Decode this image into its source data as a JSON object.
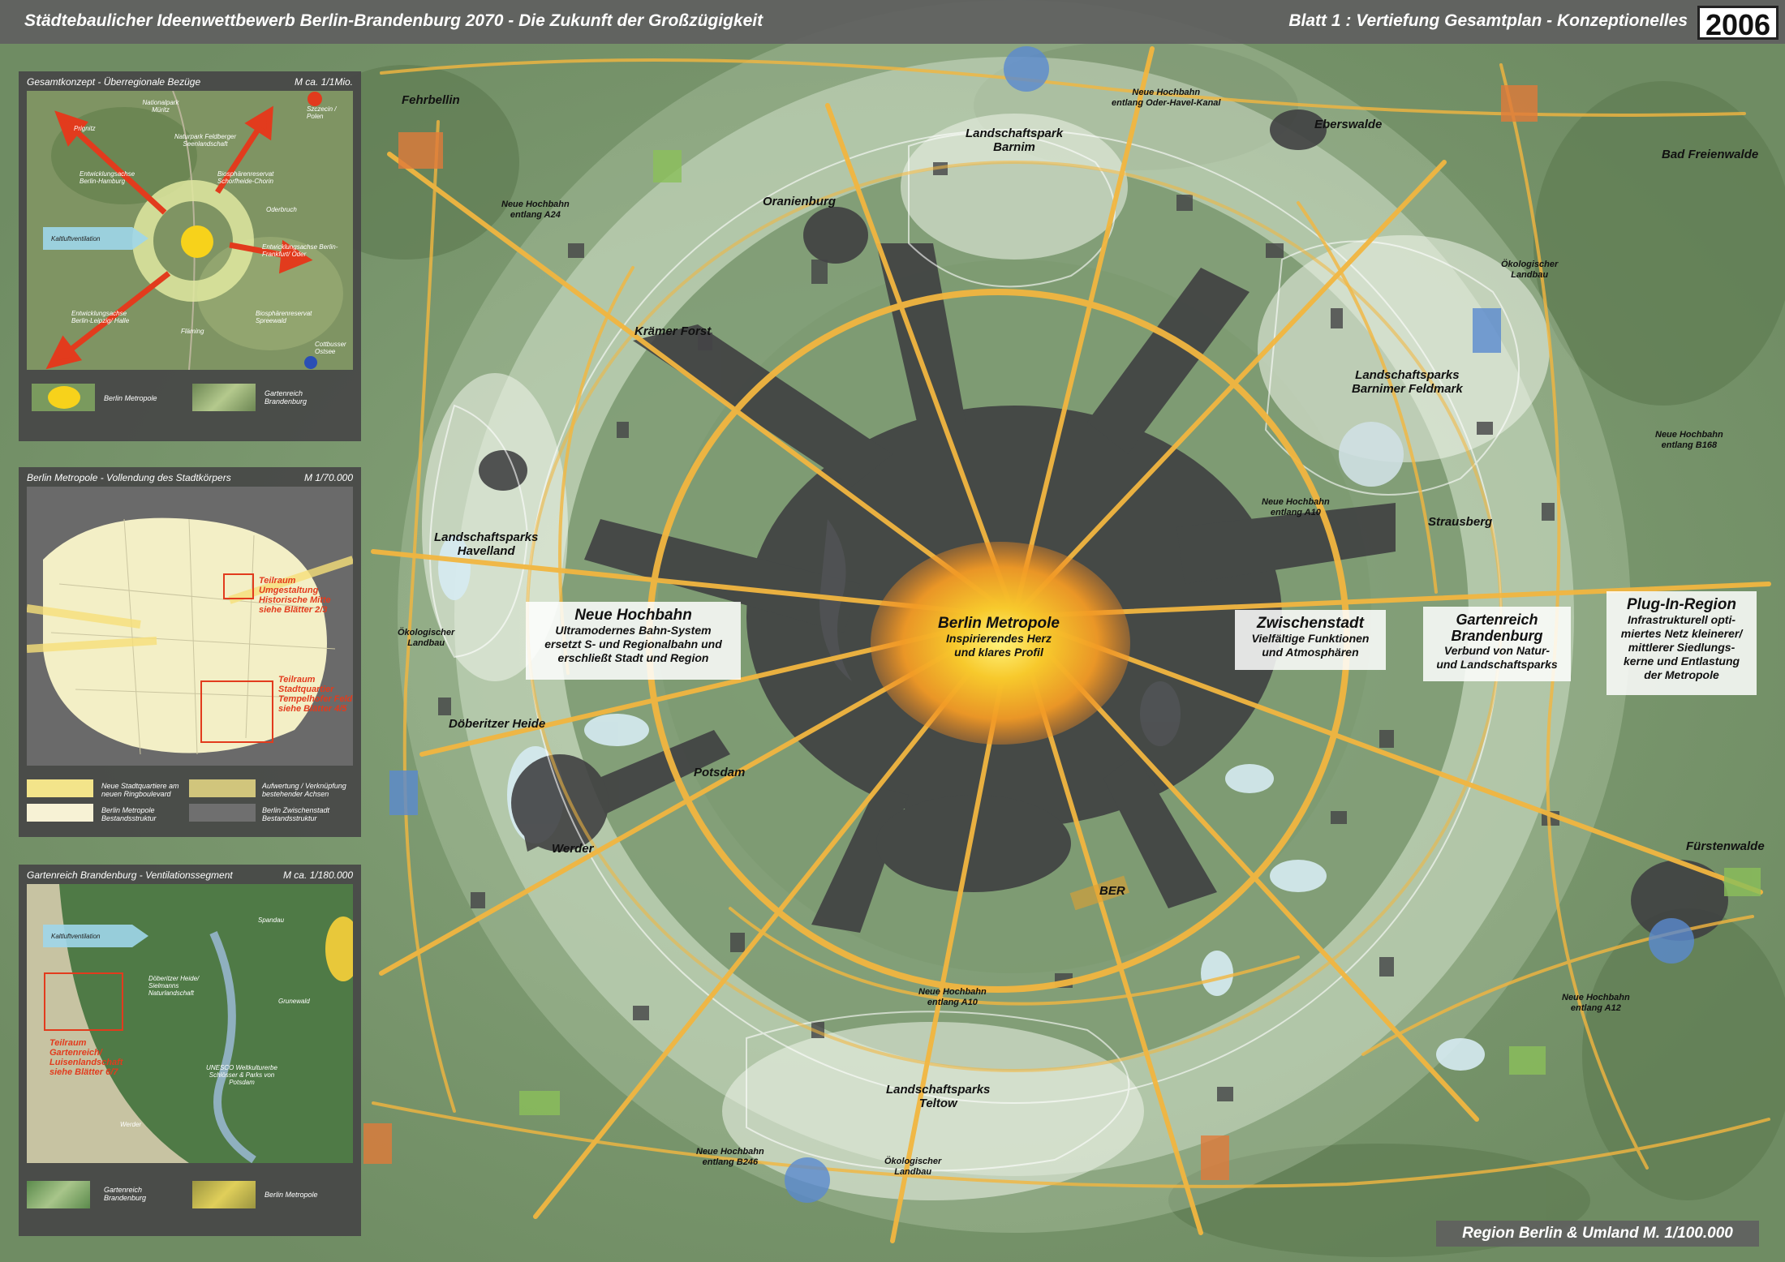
{
  "header": {
    "title_left": "Städtebaulicher Ideenwettbewerb  Berlin-Brandenburg 2070  -  Die Zukunft der Großzügigkeit",
    "title_right": "Blatt 1 :  Vertiefung Gesamtplan  -  Konzeptionelles",
    "year": "2006"
  },
  "panels": {
    "p1": {
      "title": "Gesamtkonzept  -  Überregionale Bezüge",
      "scale": "M ca. 1/1Mio.",
      "labels": {
        "prignitz": "Prignitz",
        "mueritz": "Nationalpark Müritz",
        "feldberg": "Naturpark Feldberger Seenlandschaft",
        "szczecin": "Szczecin / Polen",
        "hamburg": "Entwicklungsachse Berlin-Hamburg",
        "schorfheide": "Biosphärenreservat Schorfheide-Chorin",
        "oderbruch": "Oderbruch",
        "kaltluft": "Kaltluftventilation",
        "frankfurt": "Entwicklungsachse Berlin-Frankfurt/ Oder",
        "leipzig": "Entwicklungsachse Berlin-Leipzig/ Halle",
        "flaeming": "Fläming",
        "spreewald": "Biosphärenreservat Spreewald",
        "cottbus": "Cottbusser Ostsee"
      },
      "legend": [
        "Berlin Metropole",
        "Gartenreich Brandenburg"
      ]
    },
    "p2": {
      "title": "Berlin Metropole  -  Vollendung des Stadtkörpers",
      "scale": "M 1/70.000",
      "callout_a": [
        "Teilraum",
        "Umgestaltung",
        "Historische Mitte",
        "siehe Blätter 2/3"
      ],
      "callout_b": [
        "Teilraum",
        "Stadtquartier",
        "Tempelhofer Feld",
        "siehe Blätter 4/5"
      ],
      "legend": [
        [
          "Neue Stadtquartiere am",
          "neuen Ringboulevard"
        ],
        [
          "Aufwertung / Verknüpfung",
          "bestehender Achsen"
        ],
        [
          "Berlin Metropole",
          "Bestandsstruktur"
        ],
        [
          "Berlin Zwischenstadt",
          "Bestandsstruktur"
        ]
      ]
    },
    "p3": {
      "title": "Gartenreich Brandenburg  -  Ventilationssegment",
      "scale": "M ca. 1/180.000",
      "labels": {
        "kaltluft": "Kaltluftventilation",
        "spandau": "Spandau",
        "doeberitz": "Döberitzer Heide/ Sielmanns Naturlandschaft",
        "grunewald": "Grunewald",
        "unesco": "UNESCO Weltkulturerbe Schlösser & Parks von Potsdam",
        "werder": "Werder"
      },
      "callout": [
        "Teilraum",
        "Gartenreich/",
        "Luisenlandschaft",
        "siehe Blätter 6/7"
      ],
      "legend": [
        "Gartenreich Brandenburg",
        "Berlin Metropole"
      ]
    }
  },
  "map": {
    "places": {
      "fehrbellin": "Fehrbellin",
      "oranienburg": "Oranienburg",
      "eberswalde": "Eberswalde",
      "bad_freienwalde": "Bad Freienwalde",
      "kraemer_forst": "Krämer Forst",
      "strausberg": "Strausberg",
      "potsdam": "Potsdam",
      "werder": "Werder",
      "doeberitzer_heide": "Döberitzer Heide",
      "fuerstenwalde": "Fürstenwalde",
      "ber": "BER"
    },
    "parks": {
      "barnim": [
        "Landschaftspark",
        "Barnim"
      ],
      "barnimer_feldmark": [
        "Landschaftsparks",
        "Barnimer Feldmark"
      ],
      "havelland": [
        "Landschaftsparks",
        "Havelland"
      ],
      "teltow": [
        "Landschaftsparks",
        "Teltow"
      ]
    },
    "small_labels": {
      "hb_oder": [
        "Neue Hochbahn",
        "entlang Oder-Havel-Kanal"
      ],
      "hb_a24": [
        "Neue Hochbahn",
        "entlang A24"
      ],
      "oeko_ne": [
        "Ökologischer",
        "Landbau"
      ],
      "hb_b168": [
        "Neue Hochbahn",
        "entlang B168"
      ],
      "hb_a10_ne": [
        "Neue Hochbahn",
        "entlang A10"
      ],
      "oeko_w": [
        "Ökologischer",
        "Landbau"
      ],
      "hb_a10_s": [
        "Neue Hochbahn",
        "entlang A10"
      ],
      "hb_a12": [
        "Neue Hochbahn",
        "entlang A12"
      ],
      "hb_b246": [
        "Neue Hochbahn",
        "entlang B246"
      ],
      "oeko_s": [
        "Ökologischer",
        "Landbau"
      ]
    },
    "callouts": {
      "hochbahn": {
        "title": "Neue Hochbahn",
        "lines": [
          "Ultramodernes Bahn-System",
          "ersetzt S- und Regionalbahn und",
          "erschließt Stadt und Region"
        ]
      },
      "metropole": {
        "title": "Berlin Metropole",
        "lines": [
          "Inspirierendes Herz",
          "und klares Profil"
        ]
      },
      "zwischenstadt": {
        "title": "Zwischenstadt",
        "lines": [
          "Vielfältige Funktionen",
          "und Atmosphären"
        ]
      },
      "gartenreich": {
        "title": "Gartenreich Brandenburg",
        "lines": [
          "Verbund von Natur-",
          "und Landschaftsparks"
        ]
      },
      "plugin": {
        "title": "Plug-In-Region",
        "lines": [
          "Infrastrukturell opti-",
          "miertes Netz kleinerer/",
          "mittlerer Siedlungs-",
          "kerne und Entlastung",
          "der Metropole"
        ]
      }
    }
  },
  "footer": "Region Berlin & Umland  M. 1/100.000",
  "colors": {
    "road": "#f2b640",
    "settlement": "#3e3e40",
    "ring_light": "#e4eee0",
    "metropole_core": "#f5c52a",
    "metropole_glow": "#f08a20",
    "panel_bg": "#464646",
    "red_arrow": "#e23b1d"
  }
}
